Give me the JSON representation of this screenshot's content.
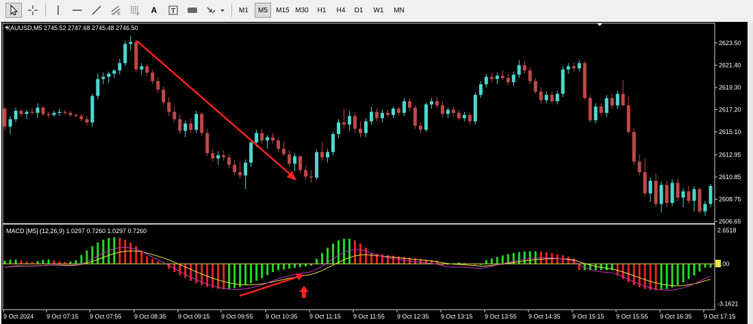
{
  "toolbar": {
    "tools": [
      {
        "name": "cursor-tool",
        "glyph": "pointer"
      },
      {
        "name": "crosshair-tool",
        "glyph": "crosshair"
      },
      {
        "name": "vertical-line-tool",
        "glyph": "vline"
      },
      {
        "name": "horizontal-line-tool",
        "glyph": "hline"
      },
      {
        "name": "trendline-tool",
        "glyph": "trend"
      },
      {
        "name": "equidistant-channel-tool",
        "glyph": "channel"
      },
      {
        "name": "fibonacci-tool",
        "glyph": "fibo"
      },
      {
        "name": "text-tool",
        "glyph": "A"
      },
      {
        "name": "text-label-tool",
        "glyph": "T"
      },
      {
        "name": "rectangle-tool",
        "glyph": "rect"
      },
      {
        "name": "arrows-dropdown",
        "glyph": "arrows"
      }
    ],
    "timeframes": [
      "M1",
      "M5",
      "M15",
      "M30",
      "H1",
      "H4",
      "D1",
      "W1",
      "MN"
    ],
    "active_timeframe": "M5"
  },
  "main_chart": {
    "label": "XAUUSD,M5  2745.52 2747.68 2745.48 2746.50",
    "price_labels": [
      "2623.50",
      "2621.40",
      "2619.30",
      "2617.20",
      "2615.10",
      "2612.95",
      "2610.85",
      "2608.75",
      "2606.65"
    ],
    "price_min": 2606.65,
    "price_max": 2624.2
  },
  "macd": {
    "label": "MACD [M5] (12,26,9) 1.0297 0.7260 1.0297 0.7260",
    "scale_labels": [
      "2.6518",
      "0.00",
      "-3.1621"
    ]
  },
  "time_labels": [
    "9 Oct 2024",
    "9 Oct 07:15",
    "9 Oct 07:55",
    "9 Oct 08:35",
    "9 Oct 09:15",
    "9 Oct 09:55",
    "9 Oct 10:35",
    "9 Oct 11:15",
    "9 Oct 11:55",
    "9 Oct 12:35",
    "9 Oct 13:15",
    "9 Oct 13:55",
    "9 Oct 14:35",
    "9 Oct 15:15",
    "9 Oct 15:55",
    "9 Oct 16:35",
    "9 Oct 17:15"
  ],
  "colors": {
    "bull_candle": "#4dd8d0",
    "bear_candle": "#c04848",
    "macd_up": "#22dd22",
    "macd_down": "#ee2222",
    "signal": "#e6e640",
    "macd_line": "#cc33cc",
    "annotation": "#ff2020"
  }
}
